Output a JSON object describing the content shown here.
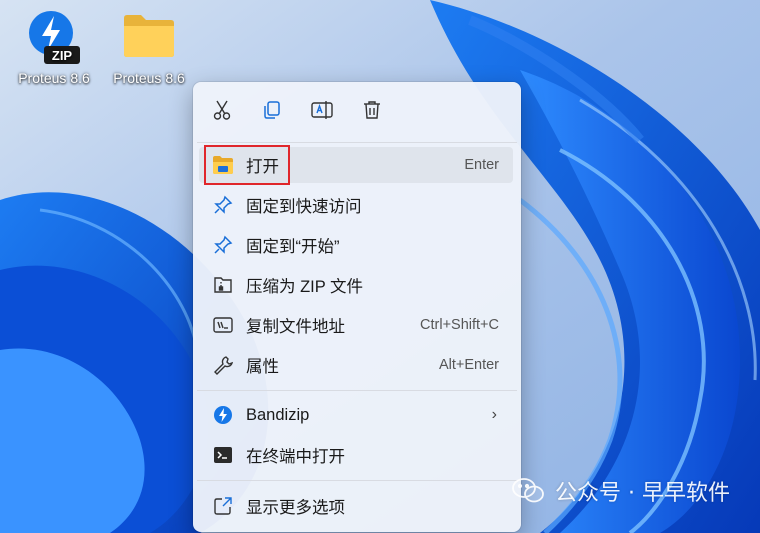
{
  "desktop": {
    "icons": [
      {
        "label": "Proteus 8.6",
        "icon": "zip-archive-icon",
        "badge": "ZIP"
      },
      {
        "label": "Proteus 8.6",
        "icon": "folder-icon"
      }
    ]
  },
  "context_menu": {
    "toolbar": [
      {
        "name": "cut",
        "icon": "scissors-icon"
      },
      {
        "name": "copy",
        "icon": "copy-icon"
      },
      {
        "name": "rename",
        "icon": "rename-icon"
      },
      {
        "name": "delete",
        "icon": "trash-icon"
      }
    ],
    "items": [
      {
        "label": "打开",
        "shortcut": "Enter",
        "icon": "folder-open-icon"
      },
      {
        "label": "固定到快速访问",
        "shortcut": "",
        "icon": "pin-icon"
      },
      {
        "label": "固定到“开始”",
        "shortcut": "",
        "icon": "pin-icon"
      },
      {
        "label": "压缩为 ZIP 文件",
        "shortcut": "",
        "icon": "zip-compress-icon"
      },
      {
        "label": "复制文件地址",
        "shortcut": "Ctrl+Shift+C",
        "icon": "copy-path-icon"
      },
      {
        "label": "属性",
        "shortcut": "Alt+Enter",
        "icon": "wrench-icon"
      },
      {
        "label": "Bandizip",
        "shortcut": "",
        "icon": "bandizip-icon",
        "submenu": true
      },
      {
        "label": "在终端中打开",
        "shortcut": "",
        "icon": "terminal-icon"
      },
      {
        "label": "显示更多选项",
        "shortcut": "",
        "icon": "more-options-icon"
      }
    ]
  },
  "watermark": {
    "text": "公众号 · 早早软件"
  },
  "colors": {
    "accent": "#0a5be0",
    "highlight_border": "#e0262b",
    "menu_bg": "#eef2fa"
  }
}
